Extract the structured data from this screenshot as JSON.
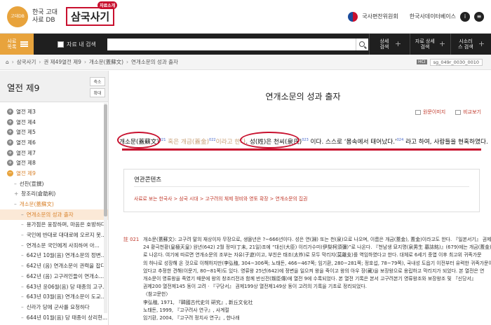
{
  "header": {
    "logo_circle": "고대DB",
    "logo_line1": "한국 고대",
    "logo_line2": "사료 DB",
    "brand": "삼국사기",
    "brand_tag": "자료소개",
    "institute": "국사편찬위원회",
    "database": "한국사데이터베이스",
    "info_icon": "i",
    "menu_icon": "≡"
  },
  "search": {
    "menu_label": "사료 목록",
    "within_label": "자료 내 검색",
    "value": "",
    "tools": [
      {
        "label": "상세 검색"
      },
      {
        "label": "자료 상세검색"
      },
      {
        "label": "시소러스 검색"
      }
    ]
  },
  "breadcrumb": {
    "items": [
      "삼국사기",
      "권 제49열전 제9",
      "개소문(蓋蘇文)",
      "연개소문의 성과 출자"
    ],
    "hci": "HCI",
    "code": "sg_049r_0030_0010"
  },
  "sidebar": {
    "title": "열전 제9",
    "collapse_label": "축소",
    "expand_label": "확대",
    "items": [
      {
        "kind": "dot",
        "label": "열전 제3"
      },
      {
        "kind": "dot",
        "label": "열전 제4"
      },
      {
        "kind": "dot",
        "label": "열전 제5"
      },
      {
        "kind": "dot",
        "label": "열전 제6"
      },
      {
        "kind": "dot",
        "label": "열전 제7"
      },
      {
        "kind": "dot",
        "label": "열전 제8"
      },
      {
        "kind": "dot-on",
        "label": "열전 제9"
      },
      {
        "kind": "dash",
        "label": "선찬(宣撰)"
      },
      {
        "kind": "plus",
        "label": "창조리(倉助利)"
      },
      {
        "kind": "dash-hl",
        "label": "개소문(蓋蘇文)"
      },
      {
        "kind": "sub-cur",
        "label": "연개소문의 성과 출자"
      },
      {
        "kind": "sub",
        "label": "용가점은 웅장하며, 마음은 호방하다"
      },
      {
        "kind": "sub",
        "label": "국인에 반대로 대대로에 오르지 못..."
      },
      {
        "kind": "sub",
        "label": "연개소문 국인에게 사죄하여 아..."
      },
      {
        "kind": "sub",
        "label": "642년 10월(음) 연개소문의 정변..."
      },
      {
        "kind": "sub",
        "label": "642년 (음) 연개소문이 권력을 잡다"
      },
      {
        "kind": "sub",
        "label": "642년 (음) 고구려인들이 연개소..."
      },
      {
        "kind": "sub",
        "label": "643년 윤06월(음) 당 태종의 고구..."
      },
      {
        "kind": "sub",
        "label": "643년 03월(음) 연개소문이 도교..."
      },
      {
        "kind": "sub",
        "label": "신라가 당에 군사를 요청하다"
      },
      {
        "kind": "sub",
        "label": "644년 01월(음) 당 태종이 상리현..."
      }
    ]
  },
  "main": {
    "title": "연개소문의 성과 출자",
    "original_image": "원문이미지",
    "compare_view": "비교보기",
    "body": {
      "name": "개소문(蓋蘇文)",
      "n1": "021",
      "faded1": "혹은 개금(蓋金)",
      "n2": "022",
      "faded2": "이라고 한다",
      "mid1": ".",
      "surname": "성(姓)은 천씨(泉氏)",
      "n3": "023",
      "after": "이다. 스스로 ‘몸속에서 태어났다.’",
      "n4": "024",
      "end": "라고 하여, 사람들을 현혹하였다."
    },
    "related": {
      "title": "연관콘텐츠",
      "text": "사료로 보는 한국사 > 삼국 시대 > 고구려의 체제 정비와 영토 확장 > 연개소문의 집권"
    },
    "footnote": {
      "id": "021",
      "lines": [
        "개소문(蓋蘇文): 고구려 말의 재상이자 무장으로, 생몰년은 ?~666년이다. 성은 연(淵) 또는 천(泉)으로 나오며, 이름은 개금(蓋金), 蓋金)이라고도 한다. 『일본서기』 권제",
        "24 황극천황(皇極天皇) 원년(642) 2월 정미(丁未, 21일)조에 “대신(大臣) 이리가수미(伊梨柯須彌)”로 나온다. 『천남생 묘지명(泉男生 墓誌銘)』(679)에는 개금(蓋金)으",
        "로 나온다. 여기에 따르면 연개소문의 조부는 자유(子遊)이고, 부친은 태조(太祚)로 모두 막리지(莫離支)를 역임하였다고 한다. 대체로 6세기 중엽 이후 최고위 귀족가문",
        "의 하나로 성장해 온 것으로 이해하지만(李弘稙, 304~306쪽; 노태돈, 466~467쪽; 임기환, 280~281쪽; 정호섭, 78~79쪽), 국내성 도읍기 이전부터 유력한 귀족가문이",
        "었다고 추정한 견해(이문기, 80~81쪽)도 있다. 영류왕 25년(642)에 정변을 일으켜 왕을 죽이고 왕의 아우 장(藏)을 보장왕으로 옹립하고 막리지가 되었다. 본 열전은 연",
        "개소문이 영류왕을 죽였기 때문에 왕의 창조리전과 함께 반신전(叛臣傳)에 열전 9에 수록되었다. 본 열전 기록은 본서 고구려본기 영류왕조와 보장왕조 및 『신당서』",
        "권제200 열전제145 동이 고려 · 『구당서』 권제199상 열전제149상 동이 고려의 기록을 기초로 정리되었다.",
        "〈참고문헌〉",
        "李弘稙, 1971, 『韓國古代史의 研究』, 新丘文化社",
        "노태돈, 1999, 『고구려사 연구』, 사계절",
        "임기환, 2004, 『고구려 정치사 연구』, 한나래"
      ]
    }
  }
}
